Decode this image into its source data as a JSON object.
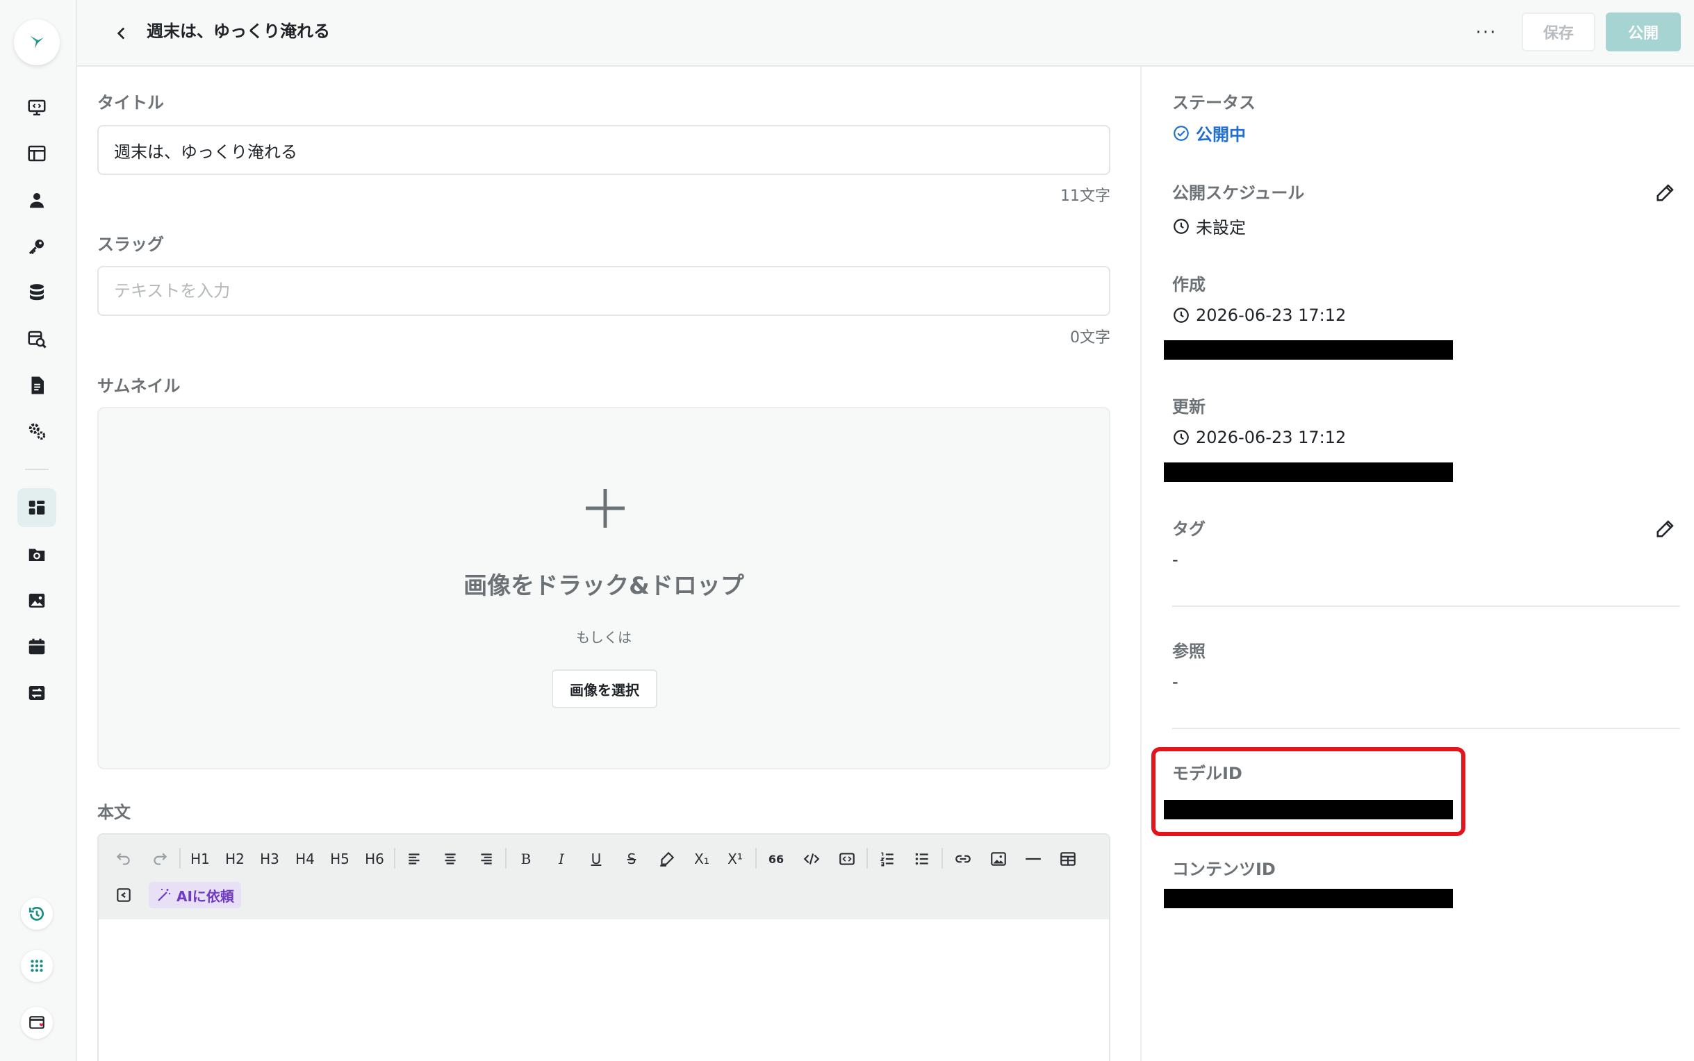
{
  "header": {
    "title": "週末は、ゆっくり淹れる",
    "more_label": "···",
    "save_label": "保存",
    "publish_label": "公開"
  },
  "form": {
    "title_label": "タイトル",
    "title_value": "週末は、ゆっくり淹れる",
    "title_count": "11文字",
    "slug_label": "スラッグ",
    "slug_placeholder": "テキストを入力",
    "slug_count": "0文字",
    "thumbnail_label": "サムネイル",
    "dropzone_title": "画像をドラック&ドロップ",
    "dropzone_or": "もしくは",
    "dropzone_button": "画像を選択",
    "body_label": "本文"
  },
  "toolbar": {
    "headings": [
      "H1",
      "H2",
      "H3",
      "H4",
      "H5",
      "H6"
    ],
    "bold": "B",
    "italic": "I",
    "underline": "U",
    "strike": "S",
    "subscript": "X₁",
    "superscript": "X¹",
    "quote": "66",
    "ai_label": "AIに依頼"
  },
  "panel": {
    "status_label": "ステータス",
    "status_value": "公開中",
    "schedule_label": "公開スケジュール",
    "schedule_value": "未設定",
    "created_label": "作成",
    "created_value": "2026-06-23 17:12",
    "updated_label": "更新",
    "updated_value": "2026-06-23 17:12",
    "tags_label": "タグ",
    "tags_value": "-",
    "ref_label": "参照",
    "ref_value": "-",
    "model_id_label": "モデルID",
    "content_id_label": "コンテンツID"
  },
  "colors": {
    "accent": "#1d8c87",
    "publish": "#a6d4d2",
    "status_blue": "#1f6fd1",
    "highlight_red": "#e3141b",
    "ai_purple": "#6f3bc4"
  }
}
